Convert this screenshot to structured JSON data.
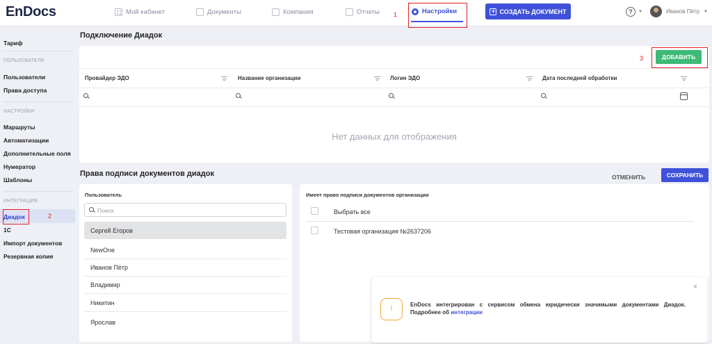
{
  "header": {
    "logo": "EnDocs",
    "nav": [
      {
        "label": "Мой кабинет",
        "icon": "grid-icon"
      },
      {
        "label": "Документы",
        "icon": "document-icon"
      },
      {
        "label": "Компания",
        "icon": "building-icon"
      },
      {
        "label": "Отчеты",
        "icon": "chart-icon"
      },
      {
        "label": "Настройки",
        "icon": "gear-icon",
        "active": true
      }
    ],
    "create_button": "СОЗДАТЬ ДОКУМЕНТ",
    "help": "?",
    "user_name": "Иванов Пётр"
  },
  "annotations": [
    "1",
    "2",
    "3"
  ],
  "sidebar": {
    "tariff": "Тариф",
    "users_section": "ПОЛЬЗОВАТЕЛИ",
    "users": "Пользователи",
    "access": "Права доступа",
    "settings_section": "НАСТРОЙКИ",
    "routes": "Маршруты",
    "automation": "Автоматизации",
    "extra_fields": "Дополнительные поля",
    "numerator": "Нумератор",
    "templates": "Шаблоны",
    "integration_section": "ИНТЕГРАЦИЯ",
    "diadoc": "Диадок",
    "onec": "1С",
    "import_docs": "Импорт документов",
    "backup": "Резервная копия"
  },
  "connection": {
    "title": "Подключение Диадок",
    "add_button": "ДОБАВИТЬ",
    "columns": [
      "Провайдер ЭДО",
      "Название организации",
      "Логин ЭДО",
      "Дата последней обработки"
    ],
    "empty_text": "Нет данных для отображения"
  },
  "signing": {
    "title": "Права подписи документов диадок",
    "cancel_button": "ОТМЕНИТЬ",
    "save_button": "СОХРАНИТЬ",
    "users_label": "Пользователь",
    "search_placeholder": "Поиск",
    "users": [
      "Сергей Егоров",
      "NewOne",
      "Иванов Пётр",
      "Владимир",
      "Никитин",
      "Ярослав"
    ],
    "orgs_label": "Имеет право подписи документов организации",
    "select_all": "Выбрать все",
    "orgs": [
      "Тестовая организация №2637206"
    ]
  },
  "toast": {
    "close": "×",
    "icon_text": "i",
    "text": "EnDocs интегрирован с сервисом обмена юридически значимыми документами Диадок. Подробнее об",
    "link": "интеграции"
  },
  "colors": {
    "accent": "#3f51d8",
    "add": "#3dba76",
    "annotation": "#e02020",
    "toast_icon": "#f0a735"
  }
}
